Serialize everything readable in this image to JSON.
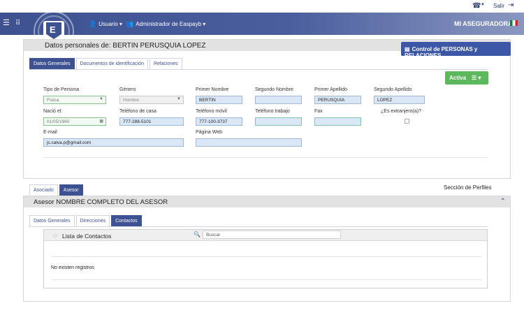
{
  "topbar": {
    "salir_label": "Salir"
  },
  "nav": {
    "usuario_label": "Usuario",
    "admin_label": "Administrador de Easpayb",
    "brand": "MI ASEGURADORA"
  },
  "panel1": {
    "title": "Datos personales de: BERTIN PERUSQUIA LOPEZ",
    "control_button": "Control de PERSONAS y RELACIONES",
    "tabs": [
      "Datos Generales",
      "Documentos de identificación",
      "Relaciones"
    ],
    "status_button": "Activa",
    "form": {
      "tipo_persona": {
        "label": "Tipo de Persona",
        "value": "Física"
      },
      "genero": {
        "label": "Género",
        "value": "Hombre"
      },
      "primer_nombre": {
        "label": "Primer Nombre",
        "value": "BERTIN"
      },
      "segundo_nombre": {
        "label": "Segundo Nombre",
        "value": ""
      },
      "primer_apellido": {
        "label": "Primer Apellido",
        "value": "PERUSQUIA"
      },
      "segundo_apellido": {
        "label": "Segundo Apellido",
        "value": "LOPEZ"
      },
      "nacio": {
        "label": "Nació el:",
        "value": "01/05/1960"
      },
      "telefono_casa": {
        "label": "Teléfono de casa",
        "value": "777-288-5101"
      },
      "telefono_movil": {
        "label": "Teléfono móvil",
        "value": "777-100-3737"
      },
      "telefono_trabajo": {
        "label": "Teléfono trabajo",
        "value": ""
      },
      "fax": {
        "label": "Fax",
        "value": ""
      },
      "extranjero": {
        "label": "¿Es extranjero(a)?"
      },
      "email": {
        "label": "E-mail",
        "value": "jc.calva.p@gmail.com"
      },
      "pagina_web": {
        "label": "Página Web",
        "value": ""
      }
    }
  },
  "section2": {
    "tabs": [
      "Asociado",
      "Asesor"
    ],
    "profiles_label": "Sección de Perfiles",
    "title": "Asesor NOMBRE COMPLETO DEL ASESOR",
    "subtabs": [
      "Datos Generales",
      "Direcciones",
      "Contactos"
    ],
    "contacts": {
      "title": "Lista de Contactos",
      "search_placeholder": "Buscar",
      "empty_text": "No existen registros"
    }
  }
}
